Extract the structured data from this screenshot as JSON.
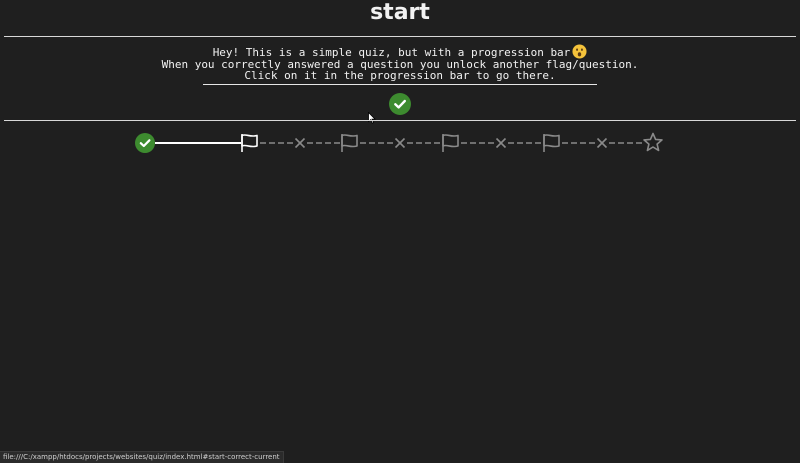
{
  "page": {
    "title": "start"
  },
  "intro": {
    "line1": "Hey! This is a simple quiz, but with a progression bar",
    "line1_emoji": "surprised-face-emoji",
    "line2": "When you correctly answered a question you unlock another flag/question.",
    "line3": "Click on it in the progression bar to go there."
  },
  "status": {
    "current_state": "correct",
    "icon": "check-circle-icon"
  },
  "progress_bar": {
    "nodes": [
      {
        "kind": "start",
        "state": "correct",
        "icon": "check-circle-icon"
      },
      {
        "kind": "flag",
        "state": "current",
        "icon": "flag-icon"
      },
      {
        "kind": "separator",
        "icon": "x-icon"
      },
      {
        "kind": "flag",
        "state": "locked",
        "icon": "flag-icon"
      },
      {
        "kind": "separator",
        "icon": "x-icon"
      },
      {
        "kind": "flag",
        "state": "locked",
        "icon": "flag-icon"
      },
      {
        "kind": "separator",
        "icon": "x-icon"
      },
      {
        "kind": "flag",
        "state": "locked",
        "icon": "flag-icon"
      },
      {
        "kind": "separator",
        "icon": "x-icon"
      },
      {
        "kind": "finish",
        "state": "locked",
        "icon": "star-icon"
      }
    ]
  },
  "statusbar": {
    "url": "file:///C:/xampp/htdocs/projects/websites/quiz/index.html#start-correct-current"
  },
  "colors": {
    "background": "#1f1f1f",
    "text": "#f2f2f2",
    "correct_green": "#3d8b2f",
    "active_line": "#ffffff",
    "locked_gray": "#8a8a8a",
    "divider": "#d8d8d8"
  }
}
